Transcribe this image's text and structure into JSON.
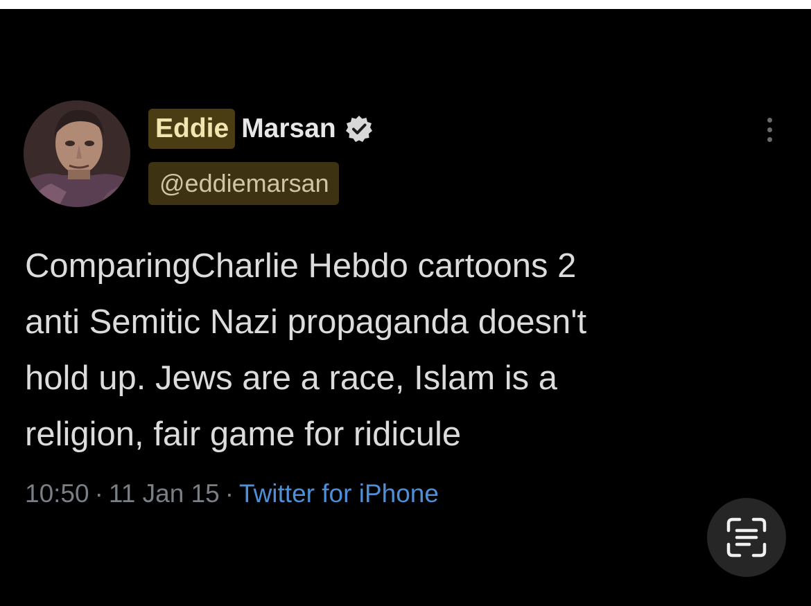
{
  "tweet": {
    "author": {
      "first_name": "Eddie",
      "last_name": "Marsan",
      "handle": "@eddiemarsan",
      "verified": true
    },
    "text": "ComparingCharlie Hebdo cartoons 2\nanti Semitic Nazi propaganda doesn't\nhold up. Jews are a race, Islam is a\nreligion, fair game for ridicule",
    "time": "10:50",
    "separator": "·",
    "date": "11 Jan 15",
    "source": "Twitter for iPhone"
  },
  "icons": {
    "more": "more-vertical-icon",
    "verified": "verified-badge-icon",
    "scan": "text-scan-icon"
  },
  "colors": {
    "background": "#000000",
    "name_highlight": "#4a3d14",
    "handle_highlight": "#3d3312",
    "text": "#dcdcdc",
    "meta": "#7a7f85",
    "link": "#4f8fd6"
  }
}
